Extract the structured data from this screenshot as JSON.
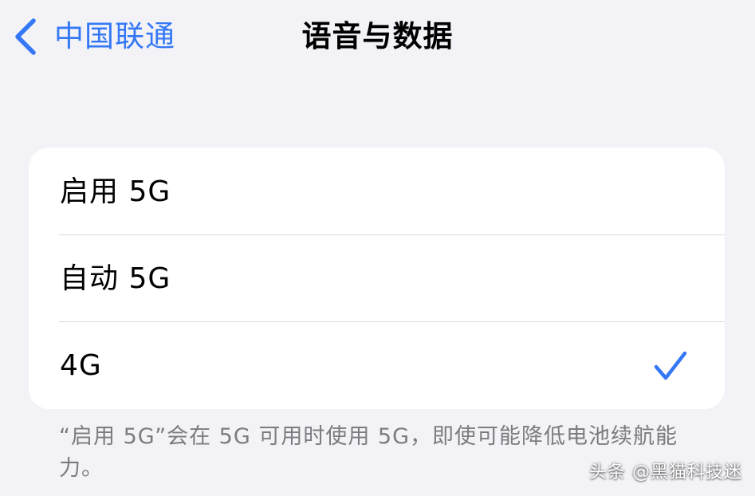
{
  "colors": {
    "accent": "#3478f6",
    "background": "#f2f2f7",
    "card": "#ffffff",
    "separator": "#d8d8dc",
    "footer_text": "#7c7c80"
  },
  "nav": {
    "back_icon": "chevron-left-icon",
    "back_label": "中国联通",
    "title": "语音与数据"
  },
  "options": [
    {
      "label": "启用 5G",
      "selected": false
    },
    {
      "label": "自动 5G",
      "selected": false
    },
    {
      "label": "4G",
      "selected": true,
      "selected_icon": "checkmark-icon"
    }
  ],
  "footer": {
    "note": "“启用 5G”会在 5G 可用时使用 5G，即使可能降低电池续航能力。"
  },
  "watermark": {
    "text": "头条 @黑猫科技迷"
  }
}
